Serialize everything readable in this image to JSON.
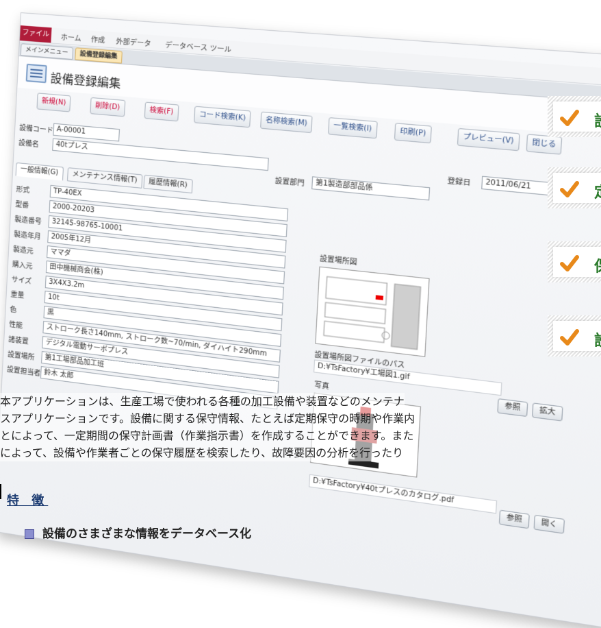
{
  "ribbon": {
    "file_tab": "ファイル",
    "tabs": [
      "ホーム",
      "作成",
      "外部データ",
      "データベース ツール"
    ]
  },
  "object_tabs": [
    "メインメニュー",
    "設備登録編集"
  ],
  "form": {
    "title": "設備登録編集",
    "toolbar": [
      "新規(N)",
      "削除(D)",
      "検索(F)",
      "コード検索(K)",
      "名称検索(M)",
      "一覧検索(I)",
      "印刷(P)",
      "プレビュー(V)",
      "閉じる"
    ],
    "code_label": "設備コード",
    "code_value": "A-00001",
    "name_label": "設備名",
    "name_value": "40tプレス",
    "dept_label": "設置部門",
    "dept_value": "第1製造部部品係",
    "date_label": "登録日",
    "date_value": "2011/06/21",
    "inner_tabs": [
      "一般情報(G)",
      "メンテナンス情報(T)",
      "履歴情報(R)"
    ],
    "fields": [
      {
        "label": "形式",
        "value": "TP-40EX"
      },
      {
        "label": "型番",
        "value": "2000-20203"
      },
      {
        "label": "製造番号",
        "value": "32145-98765-10001"
      },
      {
        "label": "製造年月",
        "value": "2005年12月"
      },
      {
        "label": "製造元",
        "value": "ママダ"
      },
      {
        "label": "購入元",
        "value": "田中機械商会(株)"
      },
      {
        "label": "サイズ",
        "value": "3X4X3.2m"
      },
      {
        "label": "重量",
        "value": "10t"
      },
      {
        "label": "色",
        "value": "黒"
      },
      {
        "label": "性能",
        "value": "ストローク長さ140mm, ストローク数~70/min, ダイハイト290mm"
      },
      {
        "label": "諸装置",
        "value": "デジタル電動サーボプレス"
      },
      {
        "label": "設置場所",
        "value": "第1工場部品加工班"
      },
      {
        "label": "設置担当者",
        "value": "鈴木 太郎"
      }
    ],
    "location_label": "設置場所図",
    "location_path_label": "設置場所図ファイルのパス",
    "location_path_value": "D:¥TsFactory¥工場図1.gif",
    "ref_button": "参照",
    "zoom_button": "拡大",
    "photo_label": "写真",
    "catalog_path": "D:¥TsFactory¥40tプレスのカタログ.pdf",
    "open_button": "開く"
  },
  "description": [
    "本アプリケーションは、生産工場で使われる各種の加工設備や装置などのメンテナ",
    "スアプリケーションです。設備に関する保守情報、たとえば定期保守の時期や作業内",
    "とによって、一定期間の保守計画書（作業指示書）を作成することができます。また",
    "によって、設備や作業者ごとの保守履歴を検索したり、故障要因の分析を行ったり"
  ],
  "features": {
    "heading": "特 徴",
    "items": [
      "設備のさまざまな情報をデータベース化"
    ]
  },
  "side_checks": [
    "設",
    "定",
    "保",
    "設"
  ],
  "colors": {
    "file_tab": "#b01c3a",
    "check": "#e8891a",
    "heading": "#1d3c72"
  }
}
